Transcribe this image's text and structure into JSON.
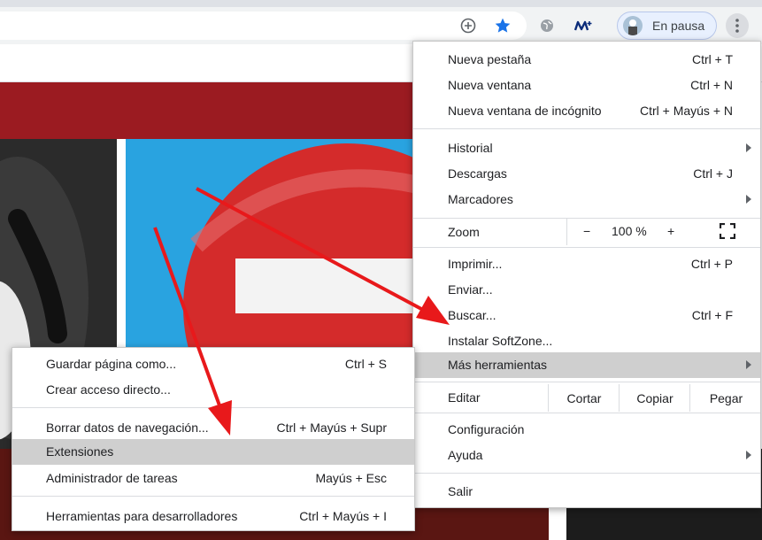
{
  "toolbar": {
    "profile_label": "En pausa",
    "icons": [
      "add-circle-icon",
      "star-icon",
      "globe-icon",
      "movistar-icon",
      "kebab-menu-icon"
    ],
    "accent": "#1a73e8"
  },
  "main_menu": {
    "items": [
      {
        "label": "Nueva pestaña",
        "shortcut": "Ctrl + T"
      },
      {
        "label": "Nueva ventana",
        "shortcut": "Ctrl + N"
      },
      {
        "label": "Nueva ventana de incógnito",
        "shortcut": "Ctrl + Mayús + N"
      },
      {
        "label": "Historial",
        "shortcut": ""
      },
      {
        "label": "Descargas",
        "shortcut": "Ctrl + J"
      },
      {
        "label": "Marcadores",
        "shortcut": ""
      },
      {
        "label": "Imprimir...",
        "shortcut": "Ctrl + P"
      },
      {
        "label": "Enviar...",
        "shortcut": ""
      },
      {
        "label": "Buscar...",
        "shortcut": "Ctrl + F"
      },
      {
        "label": "Instalar SoftZone...",
        "shortcut": ""
      },
      {
        "label": "Más herramientas",
        "shortcut": ""
      },
      {
        "label": "Configuración",
        "shortcut": ""
      },
      {
        "label": "Ayuda",
        "shortcut": ""
      },
      {
        "label": "Salir",
        "shortcut": ""
      }
    ],
    "zoom": {
      "label": "Zoom",
      "minus": "−",
      "value": "100 %",
      "plus": "+"
    },
    "edit": {
      "label": "Editar",
      "cut": "Cortar",
      "copy": "Copiar",
      "paste": "Pegar"
    }
  },
  "sub_menu": {
    "items": [
      {
        "label": "Guardar página como...",
        "shortcut": "Ctrl + S"
      },
      {
        "label": "Crear acceso directo...",
        "shortcut": ""
      },
      {
        "label": "Borrar datos de navegación...",
        "shortcut": "Ctrl + Mayús + Supr"
      },
      {
        "label": "Extensiones",
        "shortcut": ""
      },
      {
        "label": "Administrador de tareas",
        "shortcut": "Mayús + Esc"
      },
      {
        "label": "Herramientas para desarrolladores",
        "shortcut": "Ctrl + Mayús + I"
      }
    ]
  },
  "colors": {
    "highlight": "#cfcfcf",
    "arrow": "#e8191b",
    "banner": "#9b1b21",
    "blue_panel": "#29a3e0"
  }
}
